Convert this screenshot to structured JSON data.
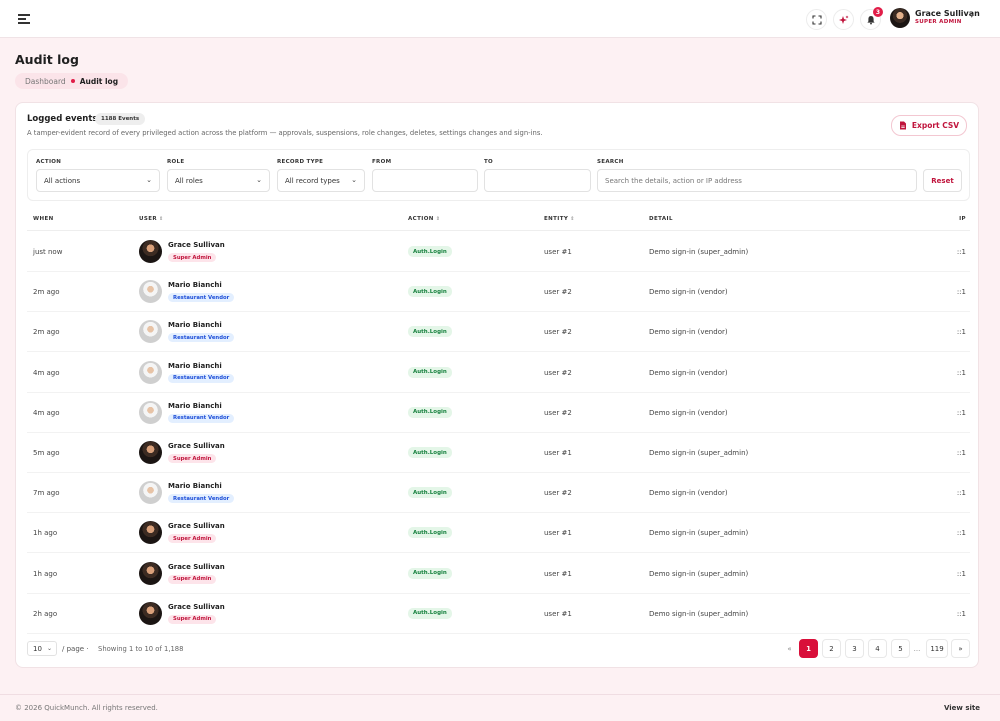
{
  "topbar": {
    "user_name": "Grace Sullivan",
    "user_role": "SUPER ADMIN",
    "notification_count": "3"
  },
  "page": {
    "title": "Audit log",
    "breadcrumb": [
      "Dashboard",
      "Audit log"
    ]
  },
  "card": {
    "title": "Logged events",
    "count_badge": "1188 Events",
    "description": "A tamper-evident record of every privileged action across the platform — approvals, suspensions, role changes, deletes, settings changes and sign-ins.",
    "export_label": "Export CSV"
  },
  "filters": {
    "action_label": "ACTION",
    "action_value": "All actions",
    "role_label": "ROLE",
    "role_value": "All roles",
    "record_type_label": "RECORD TYPE",
    "record_type_value": "All record types",
    "from_label": "FROM",
    "from_value": "",
    "to_label": "TO",
    "to_value": "",
    "search_label": "SEARCH",
    "search_placeholder": "Search the details, action or IP address",
    "reset_label": "Reset"
  },
  "table": {
    "headers": {
      "when": "WHEN",
      "user": "USER",
      "action": "ACTION",
      "entity": "ENTITY",
      "detail": "DETAIL",
      "ip": "IP"
    },
    "rows": [
      {
        "when": "just now",
        "user": "Grace Sullivan",
        "role": "Super Admin",
        "action": "Auth.Login",
        "entity": "user #1",
        "detail": "Demo sign-in (super_admin)",
        "ip": "::1"
      },
      {
        "when": "2m ago",
        "user": "Mario Bianchi",
        "role": "Restaurant Vendor",
        "action": "Auth.Login",
        "entity": "user #2",
        "detail": "Demo sign-in (vendor)",
        "ip": "::1"
      },
      {
        "when": "2m ago",
        "user": "Mario Bianchi",
        "role": "Restaurant Vendor",
        "action": "Auth.Login",
        "entity": "user #2",
        "detail": "Demo sign-in (vendor)",
        "ip": "::1"
      },
      {
        "when": "4m ago",
        "user": "Mario Bianchi",
        "role": "Restaurant Vendor",
        "action": "Auth.Login",
        "entity": "user #2",
        "detail": "Demo sign-in (vendor)",
        "ip": "::1"
      },
      {
        "when": "4m ago",
        "user": "Mario Bianchi",
        "role": "Restaurant Vendor",
        "action": "Auth.Login",
        "entity": "user #2",
        "detail": "Demo sign-in (vendor)",
        "ip": "::1"
      },
      {
        "when": "5m ago",
        "user": "Grace Sullivan",
        "role": "Super Admin",
        "action": "Auth.Login",
        "entity": "user #1",
        "detail": "Demo sign-in (super_admin)",
        "ip": "::1"
      },
      {
        "when": "7m ago",
        "user": "Mario Bianchi",
        "role": "Restaurant Vendor",
        "action": "Auth.Login",
        "entity": "user #2",
        "detail": "Demo sign-in (vendor)",
        "ip": "::1"
      },
      {
        "when": "1h ago",
        "user": "Grace Sullivan",
        "role": "Super Admin",
        "action": "Auth.Login",
        "entity": "user #1",
        "detail": "Demo sign-in (super_admin)",
        "ip": "::1"
      },
      {
        "when": "1h ago",
        "user": "Grace Sullivan",
        "role": "Super Admin",
        "action": "Auth.Login",
        "entity": "user #1",
        "detail": "Demo sign-in (super_admin)",
        "ip": "::1"
      },
      {
        "when": "2h ago",
        "user": "Grace Sullivan",
        "role": "Super Admin",
        "action": "Auth.Login",
        "entity": "user #1",
        "detail": "Demo sign-in (super_admin)",
        "ip": "::1"
      }
    ]
  },
  "pagination": {
    "per_page": "10",
    "per_page_label": "/ page ·",
    "showing": "Showing 1 to 10 of 1,188",
    "prev": "«",
    "pages": [
      "1",
      "2",
      "3",
      "4",
      "5"
    ],
    "ellipsis": "...",
    "last_page": "119",
    "next": "»",
    "current_page": "1"
  },
  "footer": {
    "copyright": "© 2026 QuickMunch. All rights reserved.",
    "view_site": "View site"
  },
  "colors": {
    "accent": "#d90f3a",
    "background": "#fdf1f3",
    "success": "#15803d"
  },
  "icons": [
    "menu-icon",
    "fullscreen-icon",
    "sparkle-icon",
    "bell-icon",
    "chevron-down-icon",
    "file-icon"
  ]
}
